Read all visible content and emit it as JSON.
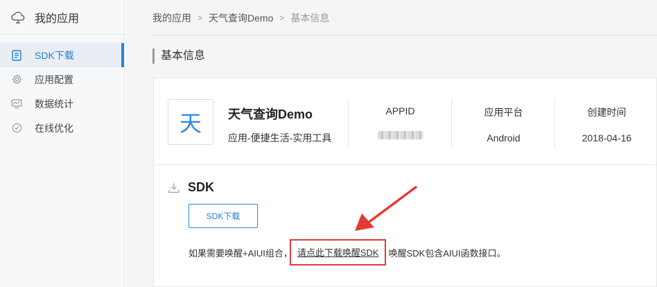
{
  "sidebar": {
    "title": "我的应用",
    "title_icon": "cloud-icon",
    "items": [
      {
        "label": "SDK下载",
        "icon": "document-icon",
        "active": true
      },
      {
        "label": "应用配置",
        "icon": "gear-icon",
        "active": false
      },
      {
        "label": "数据统计",
        "icon": "monitor-chart-icon",
        "active": false
      },
      {
        "label": "在线优化",
        "icon": "check-circle-icon",
        "active": false
      }
    ]
  },
  "breadcrumb": {
    "items": [
      "我的应用",
      "天气查询Demo",
      "基本信息"
    ],
    "separator": ">"
  },
  "page_title": "基本信息",
  "app": {
    "icon_char": "天",
    "name": "天气查询Demo",
    "category": "应用-便捷生活-实用工具",
    "stats": [
      {
        "label": "APPID",
        "value": ""
      },
      {
        "label": "应用平台",
        "value": "Android"
      },
      {
        "label": "创建时间",
        "value": "2018-04-16"
      }
    ]
  },
  "sdk": {
    "heading": "SDK",
    "heading_icon": "download-icon",
    "download_button": "SDK下载",
    "desc_before": "如果需要唤醒+AIUI组合，",
    "desc_link": "请点此下载唤醒SDK",
    "desc_after": "唤醒SDK包含AIUI函数接口。"
  },
  "colors": {
    "accent": "#1e88e5",
    "highlight_box": "#e03a3a",
    "arrow": "#e53935"
  }
}
